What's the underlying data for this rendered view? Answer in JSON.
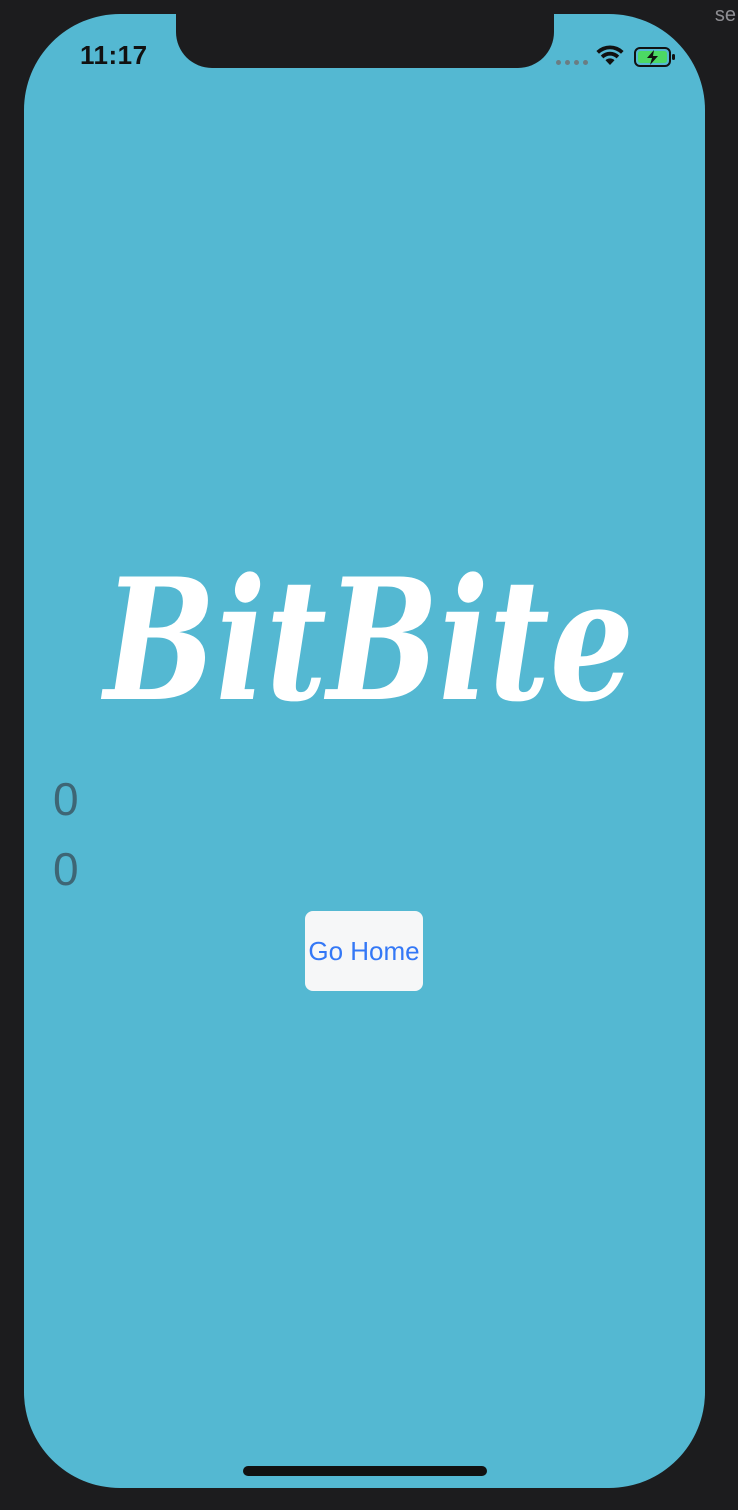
{
  "status_bar": {
    "time": "11:17",
    "icons": [
      "cellular-dots-icon",
      "wifi-icon",
      "battery-charging-icon"
    ],
    "battery_color": "#4cd964"
  },
  "window_edge_label": "se",
  "logo": {
    "text": "BitBite",
    "color": "#ffffff"
  },
  "counters": [
    "0",
    "0"
  ],
  "go_home_button": {
    "label": "Go Home",
    "text_color": "#3478f6",
    "background": "#f6f7f8"
  },
  "colors": {
    "screen_background": "#54b8d2",
    "counter_text": "#3e6675"
  }
}
